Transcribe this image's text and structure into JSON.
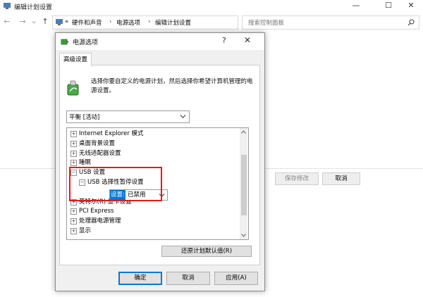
{
  "window": {
    "title": "编辑计划设置",
    "controls": {
      "minimize": "—",
      "maximize": "☐",
      "close": "✕"
    }
  },
  "nav": {
    "back": "←",
    "forward": "→",
    "dropdown": "⌄",
    "up": "↑",
    "address_prefix": "«",
    "breadcrumbs": [
      "硬件和声音",
      "电源选项",
      "编辑计划设置"
    ],
    "separator": "›"
  },
  "search": {
    "placeholder": "搜索控制面板",
    "icon": "search-icon"
  },
  "background_buttons": {
    "save": "保存修改",
    "cancel": "取消"
  },
  "dialog": {
    "title": "电源选项",
    "help": "?",
    "close": "✕",
    "tab": "高级设置",
    "description": "选择你要自定义的电源计划，然后选择你希望计算机管理的电源设置。",
    "plan_selected": "平衡 [活动]",
    "tree": [
      {
        "expander": "⊞",
        "label": "Internet Explorer 模式",
        "level": 0
      },
      {
        "expander": "⊞",
        "label": "桌面背景设置",
        "level": 0
      },
      {
        "expander": "⊞",
        "label": "无线适配器设置",
        "level": 0
      },
      {
        "expander": "⊞",
        "label": "睡眠",
        "level": 0
      },
      {
        "expander": "⊟",
        "label": "USB 设置",
        "level": 0
      },
      {
        "expander": "⊟",
        "label": "USB 选择性暂停设置",
        "level": 1
      },
      {
        "expander": "",
        "label": "",
        "level": 2
      },
      {
        "expander": "⊞",
        "label": "英特尔(R) 显卡设置",
        "level": 0
      },
      {
        "expander": "⊞",
        "label": "PCI Express",
        "level": 0
      },
      {
        "expander": "⊞",
        "label": "处理器电源管理",
        "level": 0
      },
      {
        "expander": "⊞",
        "label": "显示",
        "level": 0
      }
    ],
    "setting": {
      "label": "设置:",
      "value": "已禁用"
    },
    "restore_button": "还原计划默认值(R)",
    "buttons": {
      "ok": "确定",
      "cancel": "取消",
      "apply": "应用(A)"
    }
  },
  "colors": {
    "highlight": "#e21b1b",
    "selection": "#0078d7",
    "dialog_bg": "#f0f0f0"
  }
}
